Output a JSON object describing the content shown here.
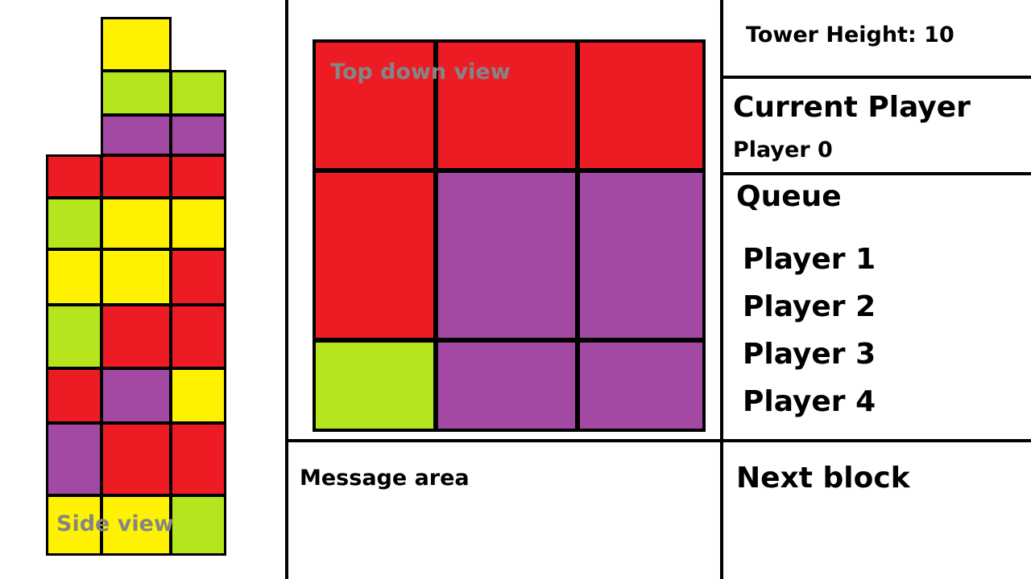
{
  "colors": {
    "red": "#ed1c24",
    "yellow": "#fff200",
    "green": "#b5e61d",
    "purple": "#a349a4",
    "label": "#858585"
  },
  "side_view": {
    "label": "Side view",
    "rows": [
      [
        "",
        "yellow",
        ""
      ],
      [
        "",
        "green",
        "green"
      ],
      [
        "",
        "purple",
        "purple"
      ],
      [
        "red",
        "red",
        "red"
      ],
      [
        "green",
        "yellow",
        "yellow"
      ],
      [
        "yellow",
        "yellow",
        "red"
      ],
      [
        "green",
        "red",
        "red"
      ],
      [
        "red",
        "purple",
        "yellow"
      ],
      [
        "purple",
        "red",
        "red"
      ],
      [
        "yellow",
        "yellow",
        "green"
      ]
    ]
  },
  "top_view": {
    "label": "Top down view",
    "rows": [
      [
        "red",
        "red",
        "red"
      ],
      [
        "red",
        "purple",
        "purple"
      ],
      [
        "green",
        "purple",
        "purple"
      ]
    ]
  },
  "tower": {
    "text": "Tower Height: 10"
  },
  "current_player": {
    "title": "Current Player",
    "value": "Player 0"
  },
  "queue": {
    "title": "Queue",
    "players": [
      "Player 1",
      "Player 2",
      "Player 3",
      "Player 4"
    ]
  },
  "message_area": {
    "label": "Message area"
  },
  "next_block": {
    "title": "Next block"
  }
}
